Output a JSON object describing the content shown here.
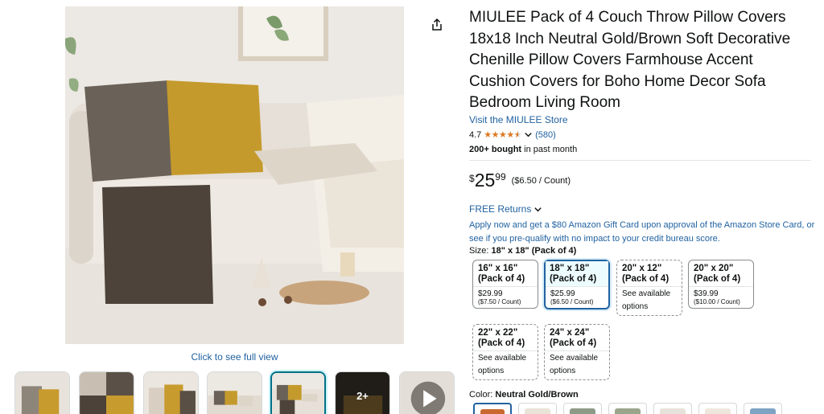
{
  "product": {
    "title": "MIULEE Pack of 4 Couch Throw Pillow Covers 18x18 Inch Neutral Gold/Brown Soft Decorative Chenille Pillow Covers Farmhouse Accent Cushion Covers for Boho Home Decor Sofa Bedroom Living Room",
    "store_link": "Visit the MIULEE Store",
    "rating": "4.7",
    "stars": 4.5,
    "rating_count": "(580)",
    "bought_bold": "200+ bought",
    "bought_rest": " in past month"
  },
  "price": {
    "symbol": "$",
    "whole": "25",
    "fraction": "99",
    "unit": "($6.50 / Count)"
  },
  "returns": "FREE Returns",
  "promo": "Apply now and get a $80 Amazon Gift Card upon approval of the Amazon Store Card, or see if you pre-qualify with no impact to your credit bureau score.",
  "size": {
    "label": "Size: ",
    "selected": "18\" x 18\" (Pack of 4)",
    "options": [
      {
        "line1": "16\" x 16\"",
        "line2": "(Pack of 4)",
        "price": "$29.99",
        "unit": "($7.50 / Count)",
        "avail": ""
      },
      {
        "line1": "18\" x 18\"",
        "line2": "(Pack of 4)",
        "price": "$25.99",
        "unit": "($6.50 / Count)",
        "avail": ""
      },
      {
        "line1": "20\" x 12\"",
        "line2": "(Pack of 4)",
        "price": "",
        "unit": "",
        "avail": "See available options"
      },
      {
        "line1": "20\" x 20\"",
        "line2": "(Pack of 4)",
        "price": "$39.99",
        "unit": "($10.00 / Count)",
        "avail": ""
      },
      {
        "line1": "22\" x 22\"",
        "line2": "(Pack of 4)",
        "price": "",
        "unit": "",
        "avail": "See available options"
      },
      {
        "line1": "24\" x 24\"",
        "line2": "(Pack of 4)",
        "price": "",
        "unit": "",
        "avail": "See available options"
      }
    ]
  },
  "color": {
    "label": "Color: ",
    "selected": "Neutral Gold/Brown",
    "swatches": [
      "#c9692f",
      "#e9e3d8",
      "#8d9a87",
      "#9aa58b",
      "#e6e2da",
      "#eee7de",
      "#7ea3c3"
    ]
  },
  "gallery": {
    "click_to_view": "Click to see full view",
    "more_badge": "2+",
    "thumb_count": 8
  },
  "icons": {
    "share": "share-icon",
    "play": "play-icon",
    "chevron": "chevron-down-icon"
  },
  "colors": {
    "link": "#2162a1",
    "star": "#de7921",
    "selected_border": "#2162a1"
  }
}
